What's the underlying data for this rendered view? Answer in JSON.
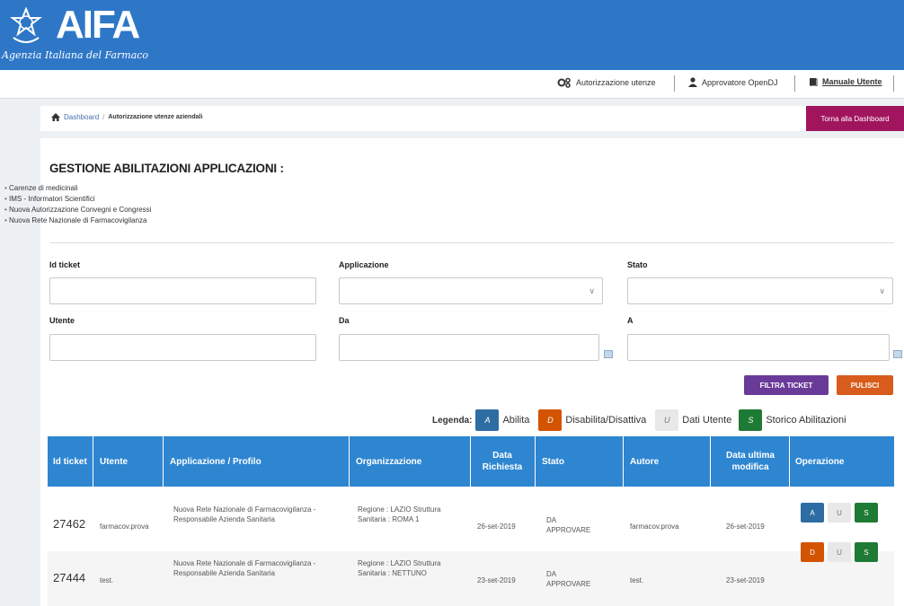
{
  "header": {
    "logo_text": "AIFA",
    "logo_subtitle": "Agenzia Italiana del Farmaco"
  },
  "usernav": {
    "autorizzazione": "Autorizzazione utenze",
    "approvatore": "Approvatore OpenDJ",
    "manuale": "Manuale Utente"
  },
  "breadcrumb": {
    "home": "Dashboard",
    "separator": "/",
    "current": "Autorizzazione utenze aziendali",
    "back_button": "Torna alla Dashboard"
  },
  "main": {
    "title": "GESTIONE ABILITAZIONI APPLICAZIONI :",
    "applications": [
      "Carenze di medicinali",
      "IMS - Informatori Scientifici",
      "Nuova Autorizzazione Convegni e Congressi",
      "Nuova Rete Nazionale di Farmacovigilanza"
    ]
  },
  "filters": {
    "id_ticket_label": "Id ticket",
    "id_ticket_value": "",
    "applicazione_label": "Applicazione",
    "applicazione_value": "",
    "stato_label": "Stato",
    "stato_value": "",
    "utente_label": "Utente",
    "utente_value": "",
    "da_label": "Da",
    "da_value": "",
    "a_label": "A",
    "a_value": "",
    "filtra_button": "FILTRA TICKET",
    "pulisci_button": "PULISCI"
  },
  "legend": {
    "title": "Legenda:",
    "items": [
      {
        "key": "A",
        "label": "Abilita",
        "color": "#2e6da4"
      },
      {
        "key": "D",
        "label": "Disabilita/Disattiva",
        "color": "#d35400"
      },
      {
        "key": "U",
        "label": "Dati Utente",
        "color": "#e8e8e8"
      },
      {
        "key": "S",
        "label": "Storico Abilitazioni",
        "color": "#1e7a35"
      }
    ]
  },
  "table": {
    "headers": [
      "Id ticket",
      "Utente",
      "Applicazione / Profilo",
      "Organizzazione",
      "Data Richiesta",
      "Stato",
      "Autore",
      "Data ultima modifica",
      "Operazione"
    ],
    "rows": [
      {
        "id": "27462",
        "utente": "farmacov.prova",
        "applicazione": "Nuova Rete Nazionale di Farmacovigilanza - Responsabile Azienda Sanitaria",
        "organizzazione": "Regione : LAZIO Struttura Sanitaria : ROMA 1",
        "data_richiesta": "26-set-2019",
        "stato": "DA APPROVARE",
        "autore": "farmacov.prova",
        "data_modifica": "26-set-2019",
        "ops": [
          "A",
          "U",
          "S"
        ]
      },
      {
        "id": "27444",
        "utente": "test.",
        "applicazione": "Nuova Rete Nazionale di Farmacovigilanza - Responsabile Azienda Sanitaria",
        "organizzazione": "Regione : LAZIO Struttura Sanitaria : NETTUNO",
        "data_richiesta": "23-set-2019",
        "stato": "DA APPROVARE",
        "autore": "test.",
        "data_modifica": "23-set-2019",
        "ops": [
          "D",
          "U",
          "S"
        ]
      }
    ]
  },
  "colors": {
    "brand_blue": "#2e77c7",
    "table_header": "#2e86d1",
    "magenta": "#a0155e",
    "filtra": "#6a3a98",
    "pulisci": "#d85c1b",
    "op_a": "#2e6da4",
    "op_d": "#d35400",
    "op_s": "#1e7a35"
  }
}
